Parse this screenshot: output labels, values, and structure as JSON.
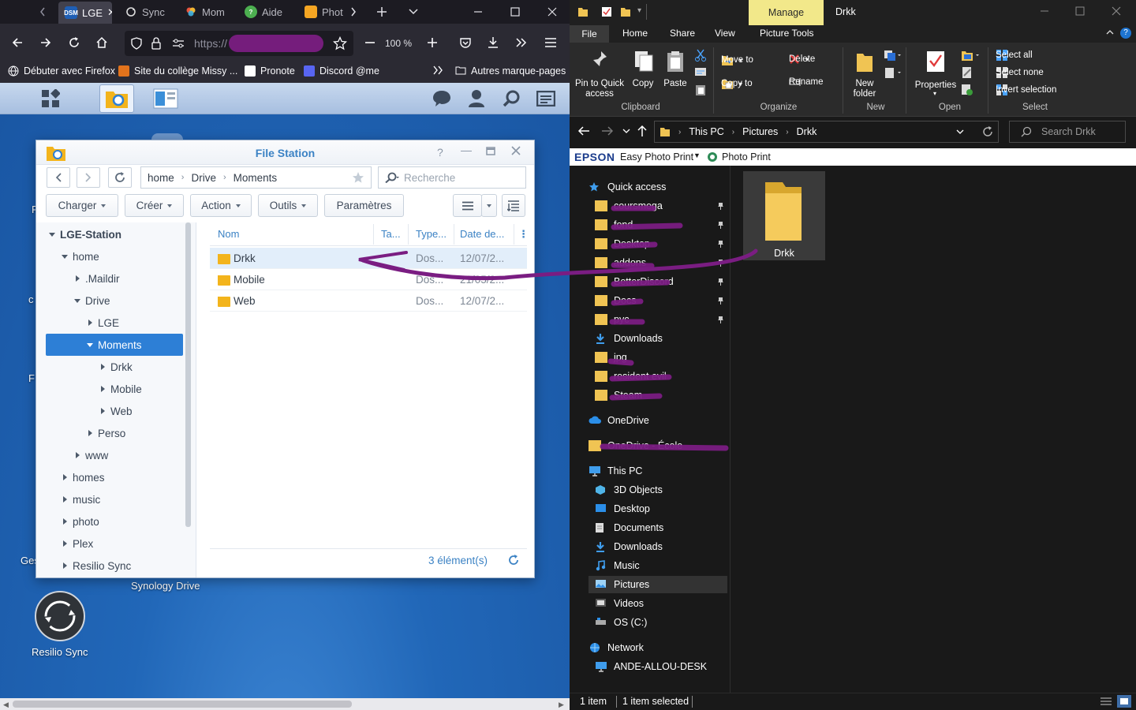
{
  "firefox": {
    "tabs": [
      {
        "label": "LGE",
        "favicon": "DSM",
        "active": true
      },
      {
        "label": "Sync",
        "favicon": "sync-icon"
      },
      {
        "label": "Mom",
        "favicon": "moments-icon"
      },
      {
        "label": "Aide",
        "favicon": "help-icon"
      },
      {
        "label": "Phot",
        "favicon": "photo-icon"
      }
    ],
    "url": "https://",
    "zoom": "100 %",
    "bookmarks": [
      "Débuter avec Firefox",
      "Site du collège Missy ...",
      "Pronote",
      "Discord @me"
    ],
    "other_bookmarks": "Autres marque-pages"
  },
  "desktop": {
    "labels": {
      "synology_drive": "Synology Drive",
      "resilio_sync": "Resilio Sync",
      "ges": "Ges"
    }
  },
  "filestation": {
    "title": "File Station",
    "breadcrumb": [
      "home",
      "Drive",
      "Moments"
    ],
    "search_placeholder": "Recherche",
    "toolbar": {
      "upload": "Charger",
      "create": "Créer",
      "action": "Action",
      "tools": "Outils",
      "settings": "Paramètres"
    },
    "tree": {
      "root": "LGE-Station",
      "home": "home",
      "maildir": ".Maildir",
      "drive": "Drive",
      "lge": "LGE",
      "moments": "Moments",
      "drkk": "Drkk",
      "mobile": "Mobile",
      "web": "Web",
      "perso": "Perso",
      "www": "www",
      "homes": "homes",
      "music": "music",
      "photo": "photo",
      "plex": "Plex",
      "resilio": "Resilio Sync"
    },
    "columns": {
      "name": "Nom",
      "size": "Ta...",
      "type": "Type...",
      "date": "Date de..."
    },
    "files": [
      {
        "name": "Drkk",
        "type": "Dos...",
        "date": "12/07/2..."
      },
      {
        "name": "Mobile",
        "type": "Dos...",
        "date": "21/05/2..."
      },
      {
        "name": "Web",
        "type": "Dos...",
        "date": "12/07/2..."
      }
    ],
    "status": "3 élément(s)"
  },
  "explorer": {
    "manage_tab": "Manage",
    "window_title": "Drkk",
    "tabs": {
      "file": "File",
      "home": "Home",
      "share": "Share",
      "view": "View",
      "picture_tools": "Picture Tools"
    },
    "ribbon": {
      "pin": "Pin to Quick\naccess",
      "copy": "Copy",
      "paste": "Paste",
      "move_to": "Move to",
      "copy_to": "Copy to",
      "delete": "Delete",
      "rename": "Rename",
      "new_folder": "New\nfolder",
      "properties": "Properties",
      "select_all": "Select all",
      "select_none": "Select none",
      "invert_selection": "Invert selection",
      "groups": {
        "clipboard": "Clipboard",
        "organize": "Organize",
        "new": "New",
        "open": "Open",
        "select": "Select"
      }
    },
    "address": [
      "This PC",
      "Pictures",
      "Drkk"
    ],
    "search_placeholder": "Search Drkk",
    "epson": {
      "brand": "EPSON",
      "app": "Easy Photo Print",
      "photo_print": "Photo Print"
    },
    "nav": {
      "quick_access": "Quick access",
      "qa_items": [
        "coursmega",
        "fond",
        "Desktop",
        "addons",
        "BetterDiscord",
        "Docs",
        "pyc"
      ],
      "downloads_qa": "Downloads",
      "qa_items2": [
        "jpg",
        "resident evil",
        "Steam"
      ],
      "onedrive": "OneDrive",
      "onedrive_folder": "OneDrive - École",
      "this_pc": "This PC",
      "pc_items": [
        "3D Objects",
        "Desktop",
        "Documents",
        "Downloads",
        "Music",
        "Pictures",
        "Videos",
        "OS (C:)"
      ],
      "network": "Network",
      "network_item": "ANDE-ALLOU-DESK"
    },
    "content_item": "Drkk",
    "status": {
      "count": "1 item",
      "selected": "1 item selected"
    }
  },
  "annotation_color": "#7a1d82"
}
